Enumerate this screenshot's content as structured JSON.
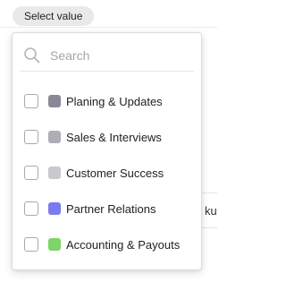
{
  "trigger": {
    "label": "Select value"
  },
  "search": {
    "placeholder": "Search",
    "value": ""
  },
  "options": [
    {
      "label": "Planing & Updates",
      "color": "#8a8894",
      "checked": false
    },
    {
      "label": "Sales & Interviews",
      "color": "#aeaeb6",
      "checked": false
    },
    {
      "label": "Customer Success",
      "color": "#c8c8cd",
      "checked": false
    },
    {
      "label": "Partner Relations",
      "color": "#7b7bf0",
      "checked": false
    },
    {
      "label": "Accounting & Payouts",
      "color": "#7ed466",
      "checked": false
    }
  ],
  "background": {
    "fragment": "ku"
  }
}
